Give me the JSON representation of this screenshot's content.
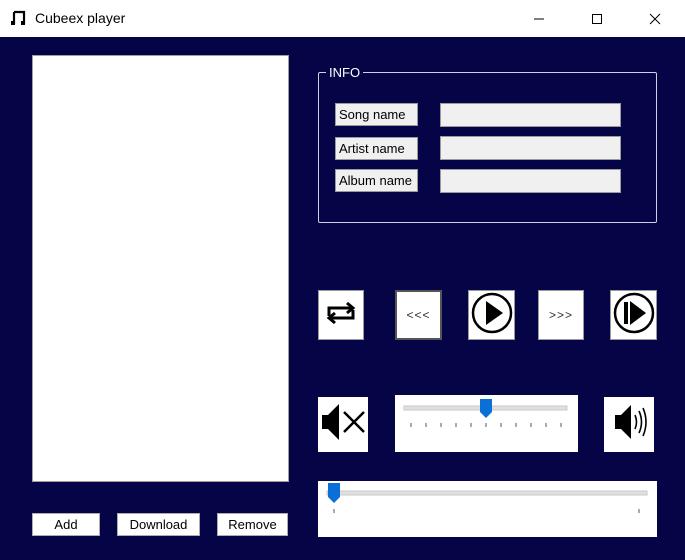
{
  "window": {
    "title": "Cubeex player"
  },
  "info": {
    "legend": "INFO",
    "song_label": "Song name",
    "artist_label": "Artist name",
    "album_label": "Album name",
    "song_value": "",
    "artist_value": "",
    "album_value": ""
  },
  "controls": {
    "prev_label": "<<<",
    "next_label": ">>>",
    "volume_level": 0.5,
    "seek_position": 0.0
  },
  "playlist": {
    "items": []
  },
  "buttons": {
    "add_label": "Add",
    "download_label": "Download",
    "remove_label": "Remove"
  },
  "colors": {
    "background": "#050447",
    "slider_thumb": "#0a6fd6"
  },
  "icons": {
    "app": "music-note-icon",
    "repeat": "repeat-icon",
    "play": "play-icon",
    "play_end": "play-end-icon",
    "mute": "mute-icon",
    "volume": "volume-icon"
  }
}
